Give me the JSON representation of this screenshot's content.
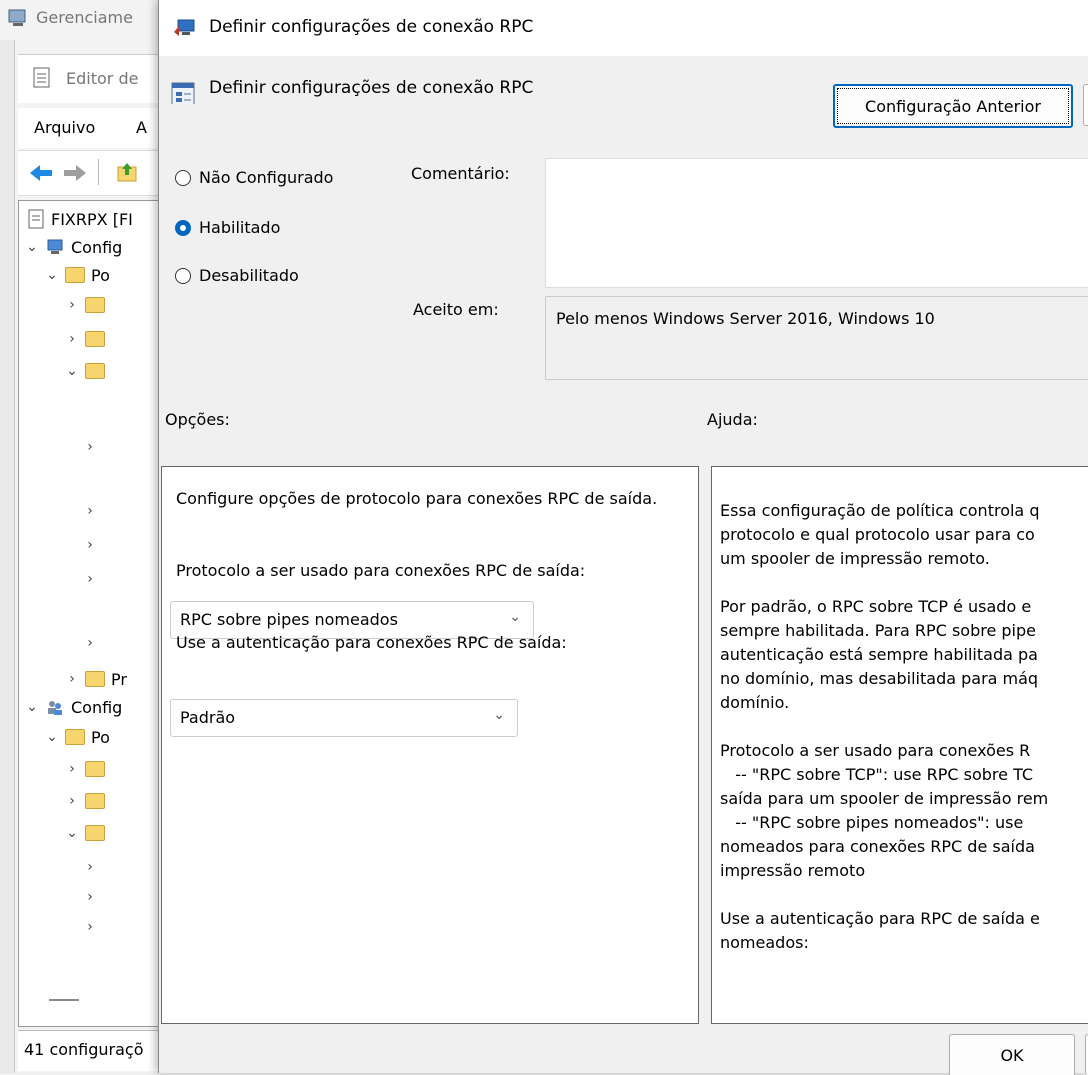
{
  "background_window": {
    "title": "Gerenciame",
    "editor_title": "Editor de",
    "menu": [
      "Arquivo",
      "A"
    ],
    "tree": [
      {
        "label": "FIXRPX [FI"
      },
      {
        "label": "Config"
      },
      {
        "label": "Po"
      },
      {
        "label": "Pr"
      },
      {
        "label": "Config"
      },
      {
        "label": "Po"
      }
    ],
    "status": "41 configuraçõ"
  },
  "dialog": {
    "title": "Definir configurações de conexão RPC",
    "heading": "Definir configurações de conexão RPC",
    "prev_button": "Configuração Anterior",
    "radios": [
      {
        "label": "Não Configurado",
        "checked": false
      },
      {
        "label": "Habilitado",
        "checked": true
      },
      {
        "label": "Desabilitado",
        "checked": false
      }
    ],
    "comment_label": "Comentário:",
    "comment_value": "",
    "supported_label": "Aceito em:",
    "supported_value": "Pelo menos Windows Server 2016, Windows 10",
    "options_label": "Opções:",
    "help_label": "Ajuda:",
    "options": {
      "intro": "Configure opções de protocolo para conexões RPC de saída.",
      "protocol_label": "Protocolo a ser usado para conexões RPC de saída:",
      "protocol_value": "RPC sobre pipes nomeados",
      "auth_label": "Use a autenticação para conexões RPC de saída:",
      "auth_value": "Padrão"
    },
    "help_lines": [
      "Essa configuração de política controla q",
      "protocolo e qual protocolo usar para co",
      "um spooler de impressão remoto.",
      "",
      "Por padrão, o RPC sobre TCP é usado e",
      "sempre habilitada. Para RPC sobre pipe",
      "autenticação está sempre habilitada pa",
      "no domínio, mas desabilitada para máq",
      "domínio.",
      "",
      "Protocolo a ser usado para conexões R",
      "   -- \"RPC sobre TCP\": use RPC sobre TC",
      "saída para um spooler de impressão rem",
      "   -- \"RPC sobre pipes nomeados\": use",
      "nomeados para conexões RPC de saída",
      "impressão remoto",
      "",
      "Use a autenticação para RPC de saída e",
      "nomeados:"
    ],
    "ok_button": "OK"
  },
  "colors": {
    "accent": "#0067c0",
    "folder": "#f6d56f"
  }
}
